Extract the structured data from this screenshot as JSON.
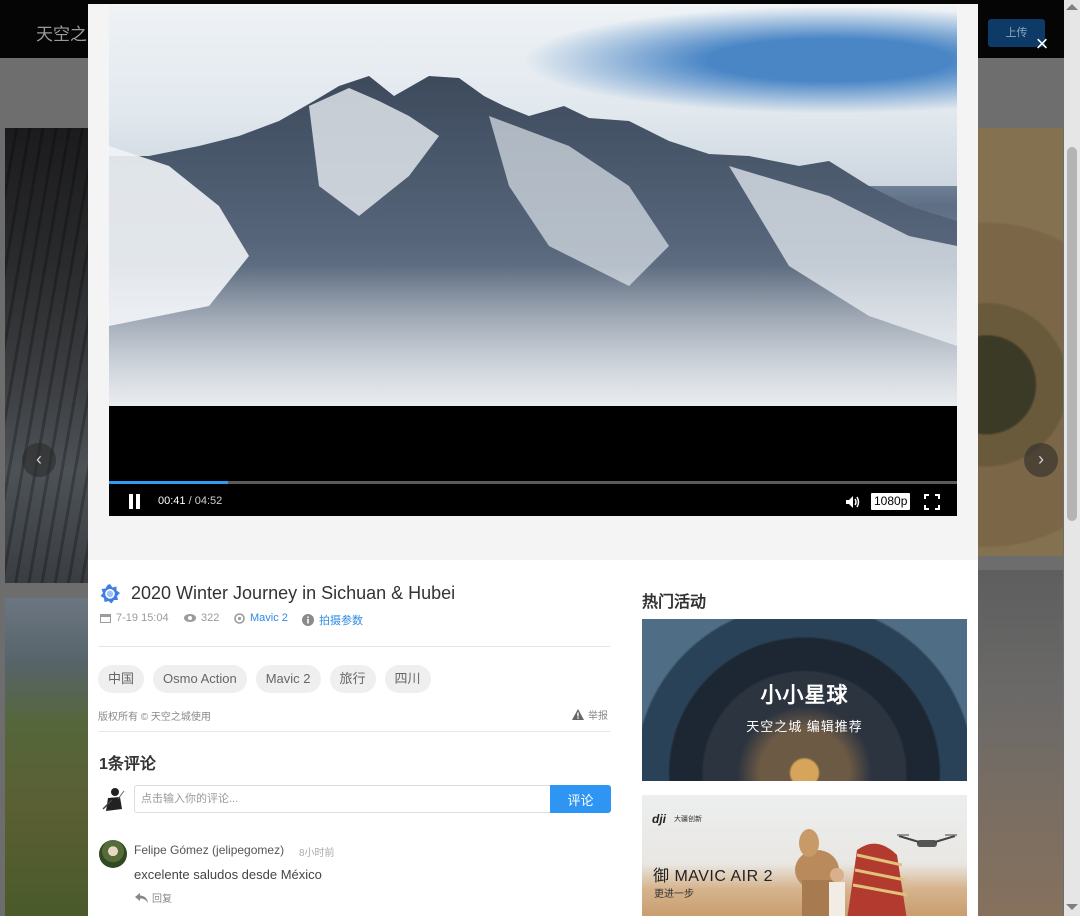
{
  "background": {
    "logo": "天空之",
    "upload_label": "上传",
    "prev_arrow": "‹",
    "next_arrow": "›"
  },
  "modal": {
    "close_symbol": "×"
  },
  "player": {
    "current_time": "00:41",
    "separator": "/",
    "duration": "04:52",
    "quality": "1080p",
    "progress": 0.14
  },
  "video": {
    "title": "2020 Winter Journey in Sichuan & Hubei",
    "date": "7-19 15:04",
    "views": "322",
    "device": "Mavic 2",
    "params_link": "拍摄参数",
    "tags": [
      "中国",
      "Osmo Action",
      "Mavic 2",
      "旅行",
      "四川"
    ],
    "copyright": "版权所有 © 天空之城使用",
    "report_label": "举报"
  },
  "comments": {
    "title": "1条评论",
    "input_placeholder": "点击输入你的评论...",
    "submit_label": "评论",
    "items": [
      {
        "user": "Felipe Gómez (jelipegomez)",
        "time": "8小时前",
        "text": "excelente saludos desde México",
        "reply_label": "回复"
      }
    ]
  },
  "sidebar": {
    "title": "热门活动",
    "promo1": {
      "title": "小小星球",
      "subtitle": "天空之城 编辑推荐"
    },
    "promo2": {
      "brand": "dji",
      "brand_sub": "大疆创新",
      "title": "御 MAVIC AIR 2",
      "subtitle": "更进一步"
    }
  },
  "colors": {
    "accent": "#2f95f2",
    "link": "#2d8be3",
    "progress": "#2f9bf4"
  }
}
